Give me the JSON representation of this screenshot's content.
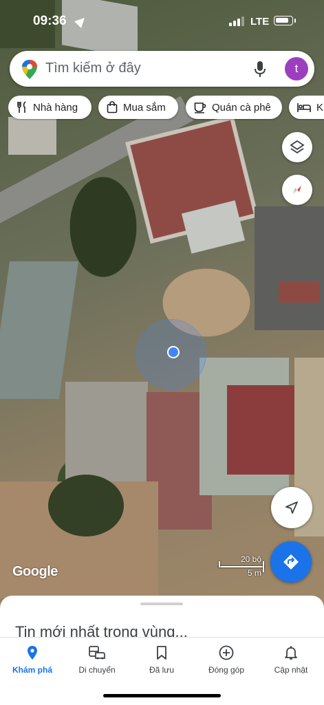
{
  "status_bar": {
    "time": "09:36",
    "network": "LTE",
    "signal_bars": 3,
    "battery_level": 0.85
  },
  "search": {
    "placeholder": "Tìm kiếm ở đây",
    "account_initial": "t"
  },
  "chips": [
    {
      "label": "Nhà hàng",
      "icon": "fork-knife-icon"
    },
    {
      "label": "Mua sắm",
      "icon": "shopping-bag-icon"
    },
    {
      "label": "Quán cà phê",
      "icon": "coffee-cup-icon"
    },
    {
      "label": "Khách sạn",
      "icon": "bed-icon"
    }
  ],
  "map": {
    "logo": "Google",
    "scale_feet": "20 bộ",
    "scale_meters": "5 m",
    "view": "satellite"
  },
  "sheet": {
    "title": "Tin mới nhất trong vùng..."
  },
  "nav": [
    {
      "label": "Khám phá",
      "icon": "location-pin-icon",
      "active": true
    },
    {
      "label": "Di chuyển",
      "icon": "commute-icon",
      "active": false
    },
    {
      "label": "Đã lưu",
      "icon": "bookmark-icon",
      "active": false
    },
    {
      "label": "Đóng góp",
      "icon": "add-circle-icon",
      "active": false
    },
    {
      "label": "Cập nhật",
      "icon": "bell-icon",
      "active": false
    }
  ],
  "colors": {
    "accent": "#1a73e8",
    "avatar": "#9b3fbf",
    "location_dot": "#4285f4"
  }
}
